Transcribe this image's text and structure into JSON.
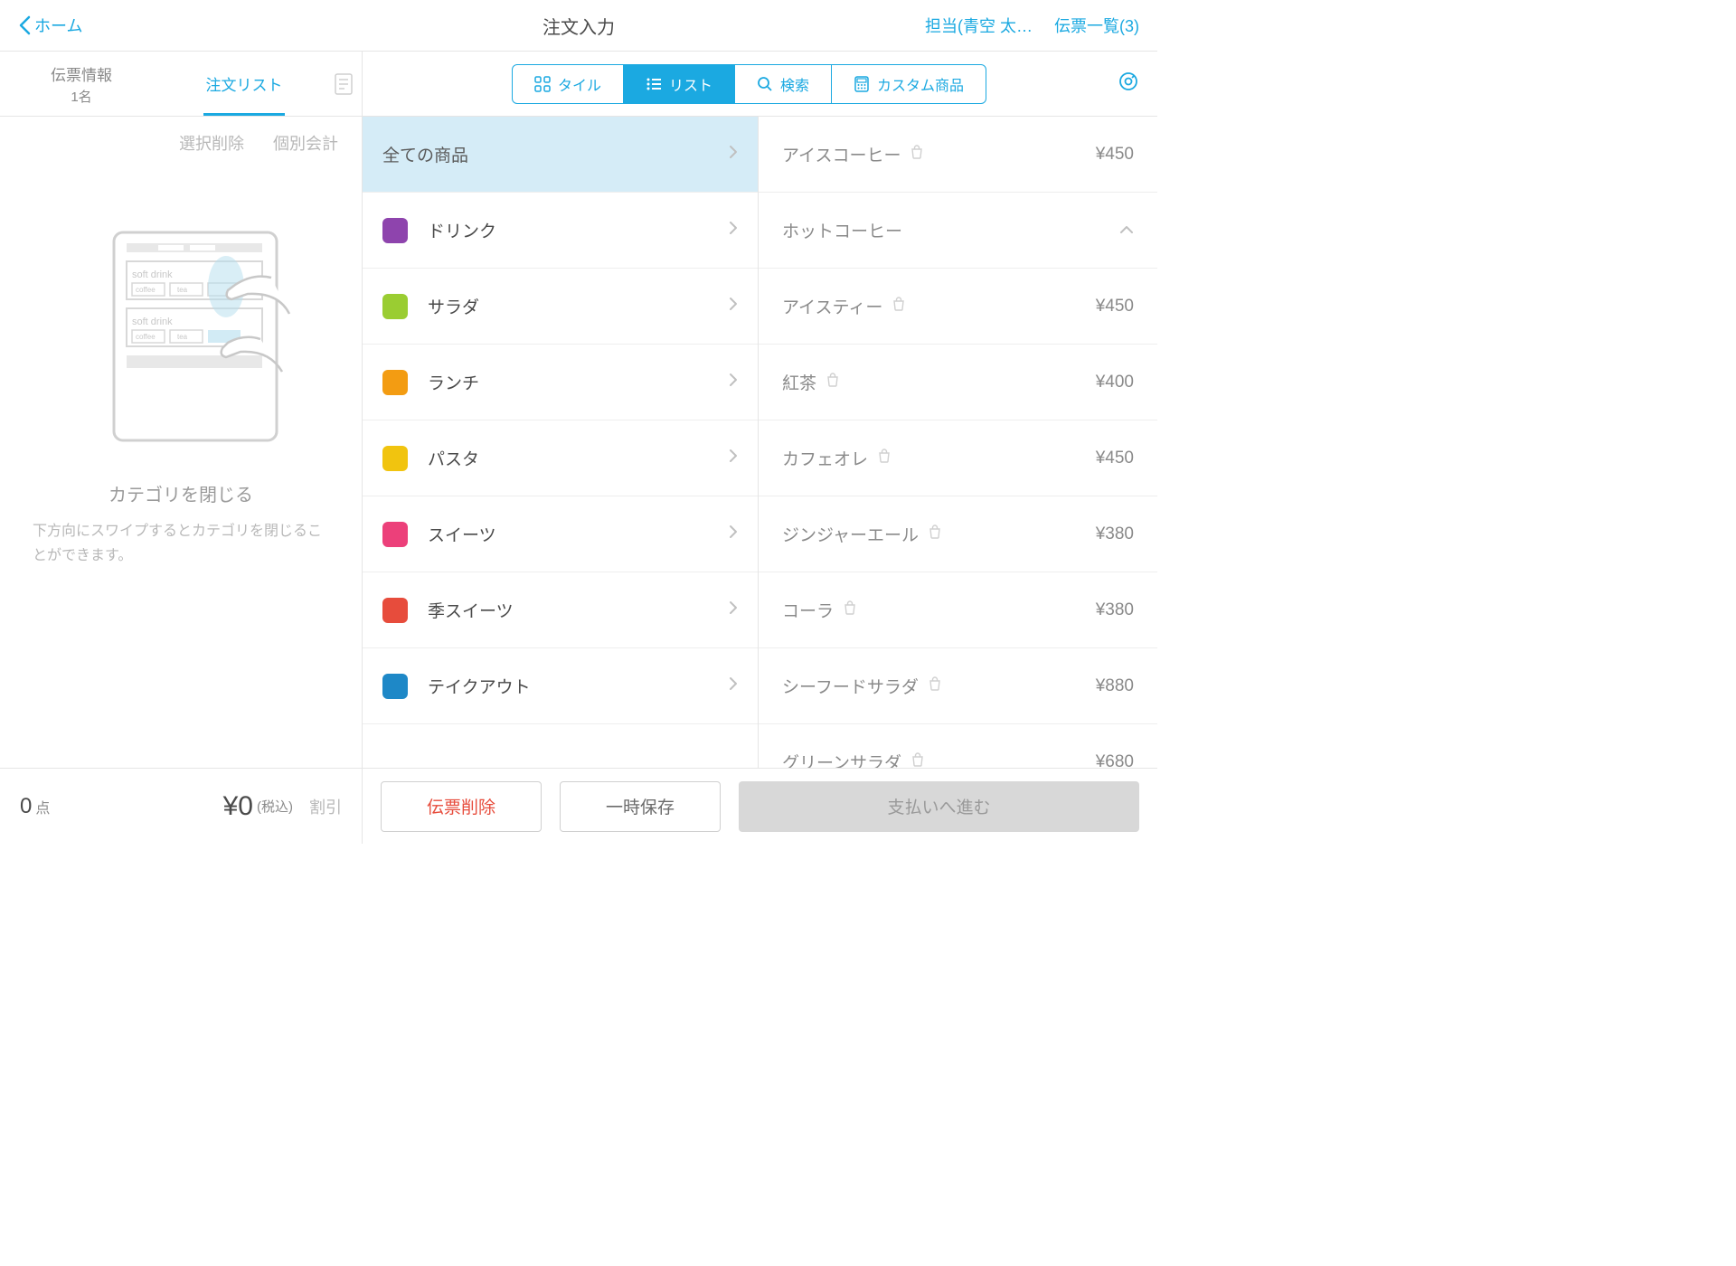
{
  "header": {
    "back_label": "ホーム",
    "title": "注文入力",
    "staff": "担当(青空 太…",
    "slip_list": "伝票一覧(3)"
  },
  "leftTabs": {
    "tab1_label": "伝票情報",
    "tab1_sub": "1名",
    "tab2_label": "注文リスト"
  },
  "leftActions": {
    "delete_selected": "選択削除",
    "individual_bill": "個別会計"
  },
  "tip": {
    "title": "カテゴリを閉じる",
    "desc": "下方向にスワイプするとカテゴリを閉じることができます。"
  },
  "leftFooter": {
    "count": "0",
    "count_unit": "点",
    "total": "¥0",
    "tax": "(税込)",
    "discount": "割引"
  },
  "viewTabs": {
    "tile": "タイル",
    "list": "リスト",
    "search": "検索",
    "custom": "カスタム商品"
  },
  "categories": [
    {
      "label": "全ての商品",
      "color": null,
      "expanded": true
    },
    {
      "label": "ドリンク",
      "color": "#8e44ad"
    },
    {
      "label": "サラダ",
      "color": "#9acd32"
    },
    {
      "label": "ランチ",
      "color": "#f39c12"
    },
    {
      "label": "パスタ",
      "color": "#f1c40f"
    },
    {
      "label": "スイーツ",
      "color": "#ec407a"
    },
    {
      "label": "季スイーツ",
      "color": "#e74c3c"
    },
    {
      "label": "テイクアウト",
      "color": "#1e88c7"
    }
  ],
  "products": [
    {
      "name": "アイスコーヒー",
      "price": "¥450",
      "bag": true
    },
    {
      "name": "ホットコーヒー",
      "price": "",
      "bag": false,
      "expandable": true
    },
    {
      "name": "アイスティー",
      "price": "¥450",
      "bag": true
    },
    {
      "name": "紅茶",
      "price": "¥400",
      "bag": true
    },
    {
      "name": "カフェオレ",
      "price": "¥450",
      "bag": true
    },
    {
      "name": "ジンジャーエール",
      "price": "¥380",
      "bag": true
    },
    {
      "name": "コーラ",
      "price": "¥380",
      "bag": true
    },
    {
      "name": "シーフードサラダ",
      "price": "¥880",
      "bag": true
    },
    {
      "name": "グリーンサラダ",
      "price": "¥680",
      "bag": true
    }
  ],
  "rightFooter": {
    "delete": "伝票削除",
    "hold": "一時保存",
    "pay": "支払いへ進む"
  },
  "ill": {
    "soft1": "soft drink",
    "soft2": "soft drink",
    "coffee": "coffee",
    "tea": "tea"
  }
}
